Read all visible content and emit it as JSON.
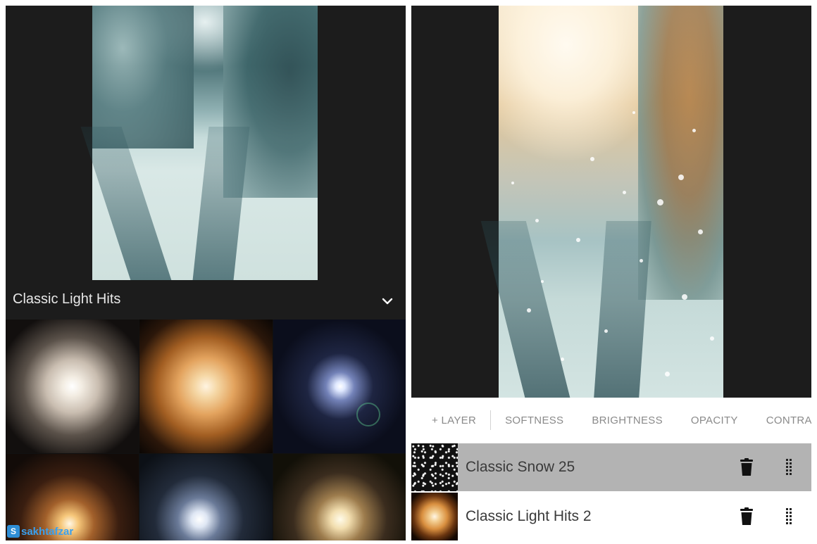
{
  "left": {
    "category": {
      "title": "Classic Light Hits",
      "toggle_icon": "chevron-down-icon"
    },
    "overlays": [
      {
        "name": "light-hit-white-glow"
      },
      {
        "name": "light-hit-orange-glow"
      },
      {
        "name": "light-hit-blue-flare"
      },
      {
        "name": "light-hit-warm-low"
      },
      {
        "name": "light-hit-cool-low"
      },
      {
        "name": "light-hit-yellow-low"
      }
    ],
    "watermark": {
      "mark": "S",
      "text": "sakhtafzar"
    }
  },
  "right": {
    "toolbar": {
      "add_layer": "+ LAYER",
      "softness": "SOFTNESS",
      "brightness": "BRIGHTNESS",
      "opacity": "OPACITY",
      "contrast": "CONTRAST"
    },
    "layers": [
      {
        "name": "Classic Snow 25",
        "selected": true,
        "actions": [
          "trash-icon",
          "drag-handle-icon"
        ]
      },
      {
        "name": "Classic Light Hits 2",
        "selected": false,
        "actions": [
          "trash-icon",
          "drag-handle-icon"
        ]
      }
    ]
  },
  "colors": {
    "panel_dark": "#1c1c1c",
    "selected_row": "#b3b3b3",
    "toolbar_text": "#8a8a8a",
    "watermark_blue": "#2e8ed6"
  }
}
